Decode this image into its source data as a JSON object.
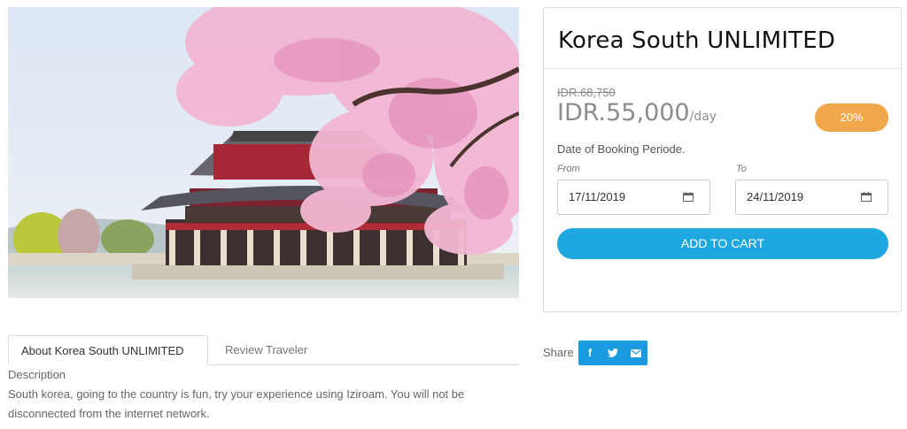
{
  "product": {
    "title": "Korea South UNLIMITED",
    "old_price": "IDR.68,750",
    "price": "IDR.55,000",
    "price_unit": "/day",
    "discount": "20%"
  },
  "booking": {
    "label": "Date of Booking Periode.",
    "from_label": "From",
    "to_label": "To",
    "from_value": "17/11/2019",
    "to_value": "24/11/2019",
    "add_to_cart": "ADD TO CART"
  },
  "tabs": [
    {
      "label": "About Korea South UNLIMITED",
      "active": true
    },
    {
      "label": "Review Traveler",
      "active": false
    }
  ],
  "description": {
    "title": "Description",
    "text": "South korea, going to the country is fun, try your experience using Iziroam. You will not be disconnected from the internet network."
  },
  "share": {
    "label": "Share",
    "buttons": [
      {
        "icon": "facebook-icon",
        "glyph": "f"
      },
      {
        "icon": "twitter-icon",
        "glyph": "t"
      },
      {
        "icon": "email-icon",
        "glyph": "✉"
      }
    ]
  },
  "colors": {
    "accent": "#1fa7e0",
    "discount": "#f0a84a",
    "share": "#1a9be0"
  }
}
